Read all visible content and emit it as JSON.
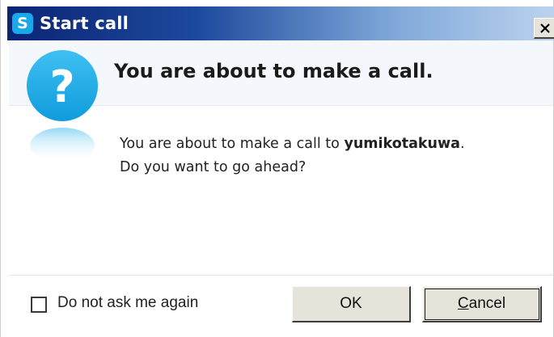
{
  "window": {
    "title": "Start call",
    "app_icon_letter": "S",
    "close_icon": "close-icon"
  },
  "header": {
    "heading": "You are about to make a call.",
    "icon": "question-icon",
    "icon_glyph": "?"
  },
  "message": {
    "line1_prefix": "You are about to make a call to ",
    "contact": "yumikotakuwa",
    "line1_suffix": ".",
    "line2": "Do you want to go ahead?"
  },
  "footer": {
    "checkbox_label": "Do not ask me again",
    "checkbox_checked": false,
    "ok_label": "OK",
    "cancel_mnemonic": "C",
    "cancel_rest": "ancel"
  },
  "colors": {
    "title_gradient_start": "#0b2474",
    "title_gradient_end": "#bcd3ee",
    "skype_blue": "#1aa8e8",
    "button_face": "#e6e3da"
  }
}
